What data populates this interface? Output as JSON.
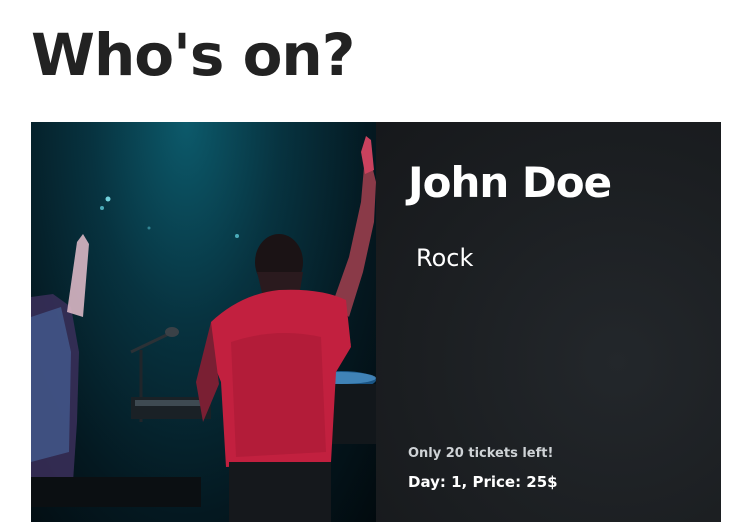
{
  "page": {
    "title": "Who's on?"
  },
  "card": {
    "artist_name": "John Doe",
    "genre": "Rock",
    "tickets_left_text": "Only 20 tickets left!",
    "day_price_text": "Day: 1, Price: 25$"
  },
  "colors": {
    "card_background": "#1c1f23",
    "title_text": "#222222",
    "card_text": "#ffffff",
    "stage_light": "#0c5a6b",
    "performer_shirt": "#c2203f"
  }
}
